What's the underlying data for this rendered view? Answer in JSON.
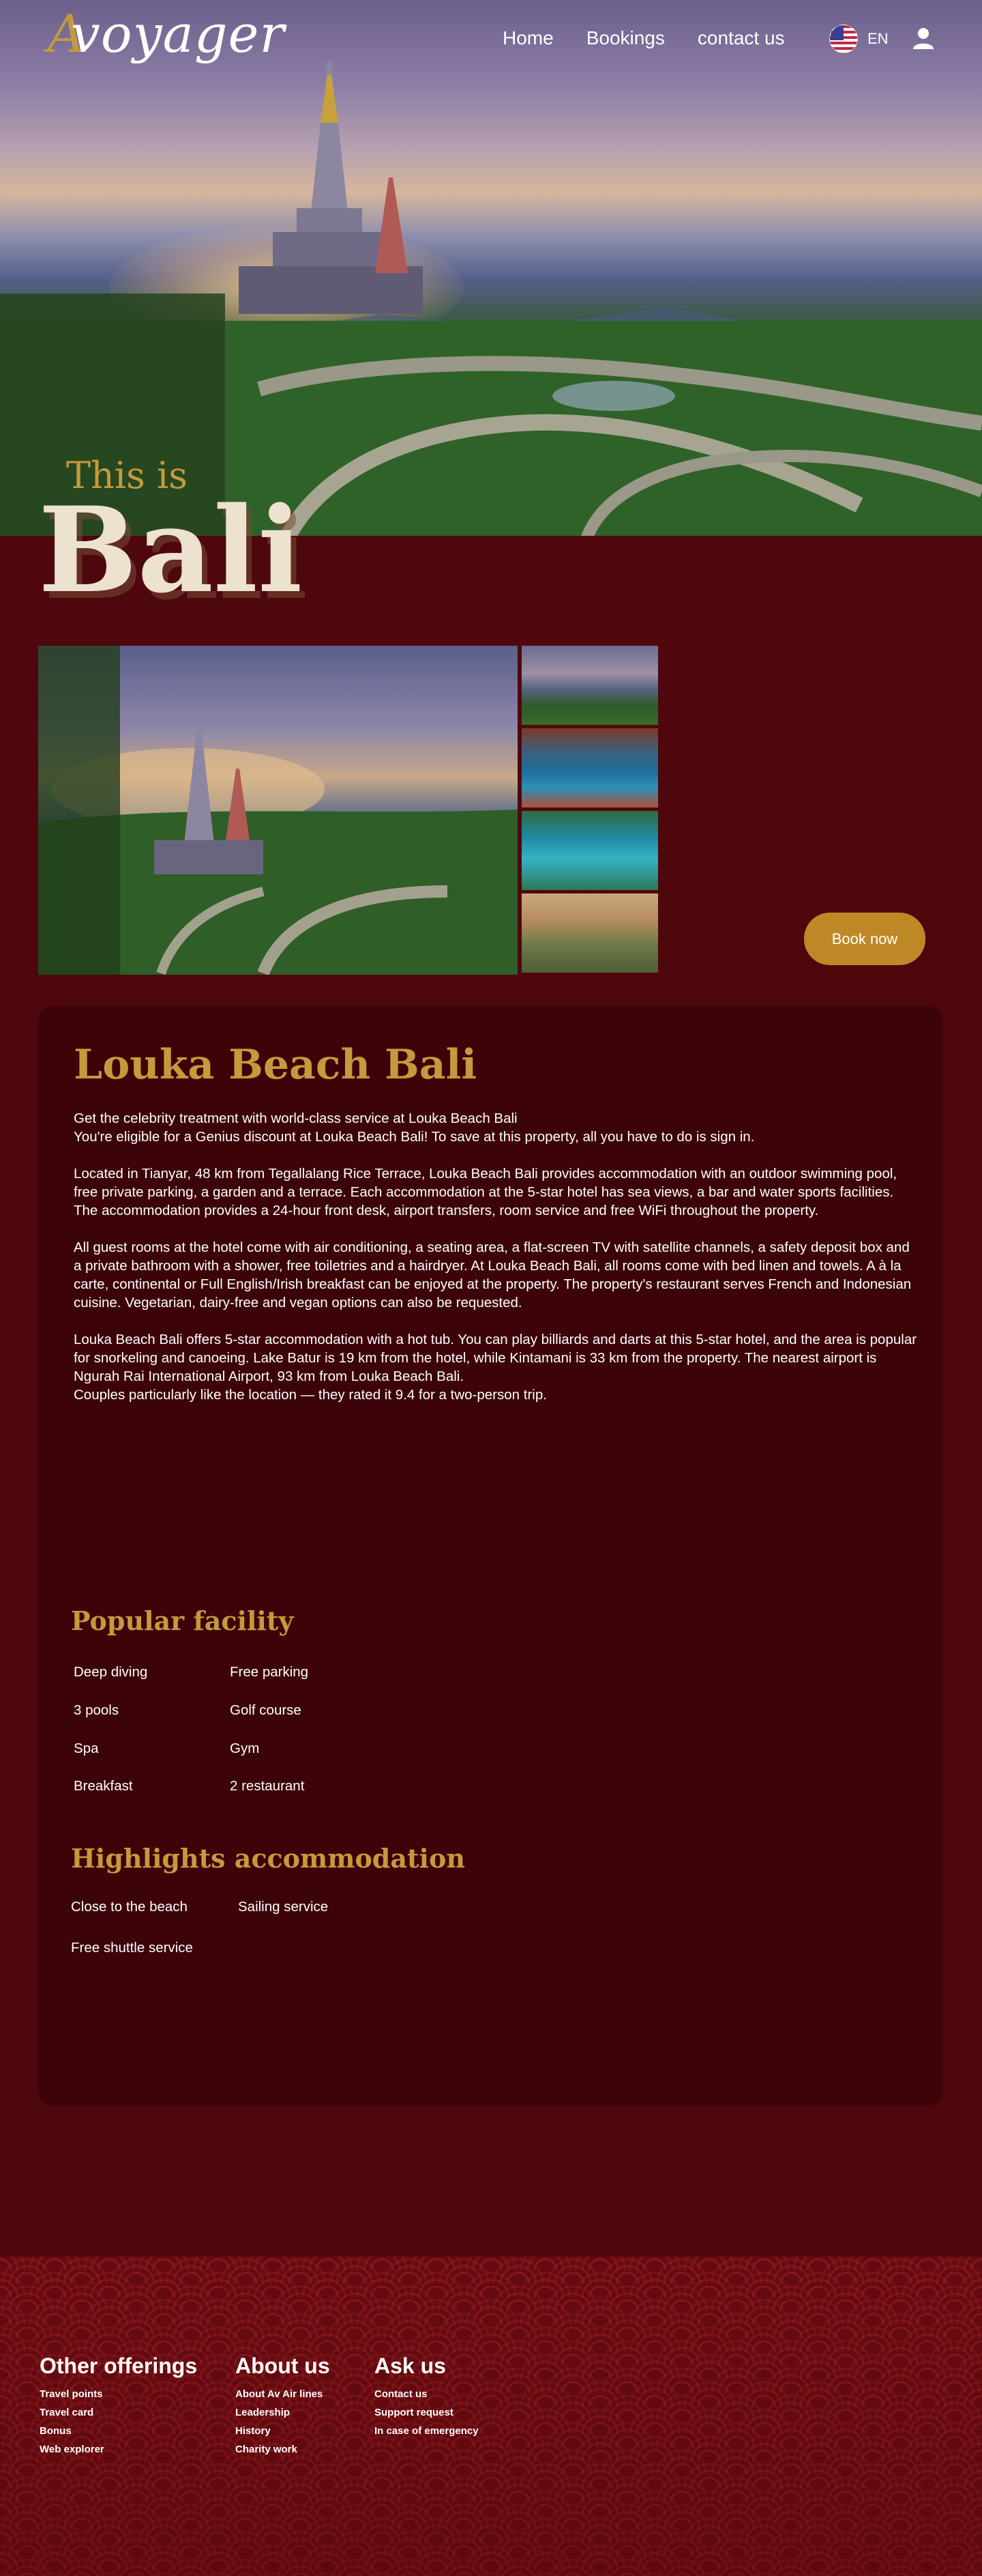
{
  "header": {
    "logo_text": "voyager",
    "logo_mark": "A",
    "nav": [
      {
        "label": "Home"
      },
      {
        "label": "Bookings"
      },
      {
        "label": "contact us"
      }
    ],
    "language": "EN",
    "icons": {
      "flag": "us-flag-icon",
      "user": "user-icon"
    }
  },
  "hero": {
    "subtitle": "This is",
    "title": "Bali"
  },
  "gallery": {
    "images": [
      "temple-pagodas-main",
      "temple-pagodas",
      "resort-pool",
      "turquoise-bay",
      "beach-hotel"
    ]
  },
  "book_now_label": "Book now",
  "hotel": {
    "name": "Louka Beach Bali",
    "paragraphs": [
      "Get the celebrity treatment with world-class service at Louka Beach Bali\nYou're eligible for a Genius discount at Louka Beach Bali! To save at this property, all you have to do is sign in.",
      "Located in Tianyar, 48 km from Tegallalang Rice Terrace, Louka Beach Bali provides accommodation with an outdoor swimming pool, free private parking, a garden and a terrace. Each accommodation at the 5-star hotel has sea views, a bar and water sports facilities. The accommodation provides a 24-hour front desk, airport transfers, room service and free WiFi throughout the property.",
      "All guest rooms at the hotel come with air conditioning, a seating area, a flat-screen TV with satellite channels, a safety deposit box and a private bathroom with a shower, free toiletries and a hairdryer. At Louka Beach Bali, all rooms come with bed linen and towels. A à la carte, continental or Full English/Irish breakfast can be enjoyed at the property. The property's restaurant serves French and Indonesian cuisine. Vegetarian, dairy-free and vegan options can also be requested.",
      "Louka Beach Bali offers 5-star accommodation with a hot tub. You can play billiards and darts at this 5-star hotel, and the area is popular for snorkeling and canoeing. Lake Batur is 19 km from the hotel, while Kintamani is 33 km from the property. The nearest airport is Ngurah Rai International Airport, 93 km from Louka Beach Bali.\nCouples particularly like the location — they rated it 9.4 for a two-person trip."
    ]
  },
  "popular_facility": {
    "title": "Popular facility",
    "items": [
      "Deep diving",
      "Free parking",
      "3 pools",
      "Golf course",
      "Spa",
      "Gym",
      "Breakfast",
      "2 restaurant"
    ]
  },
  "highlights": {
    "title": "Highlights accommodation",
    "items": [
      "Close to the beach",
      "Sailing service",
      "Free shuttle service"
    ]
  },
  "footer": {
    "columns": [
      {
        "title": "Other offerings",
        "links": [
          "Travel points",
          "Travel card",
          "Bonus",
          "Web explorer"
        ]
      },
      {
        "title": "About us",
        "links": [
          "About Av Air lines",
          "Leadership",
          "History",
          "Charity work"
        ]
      },
      {
        "title": "Ask us",
        "links": [
          "Contact us",
          "Support request",
          "In case of emergency"
        ]
      }
    ]
  },
  "colors": {
    "background": "#4e070d",
    "card": "#3c0409",
    "accent_gold": "#c49a3c",
    "button": "#bf8826",
    "footer": "#6a0b12"
  }
}
